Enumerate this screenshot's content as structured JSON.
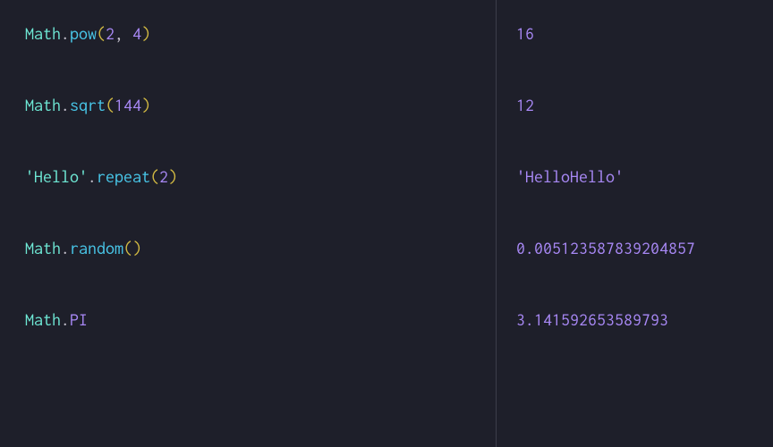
{
  "rows": [
    {
      "input": [
        {
          "cls": "tok-obj",
          "t": "Math"
        },
        {
          "cls": "tok-dot",
          "t": "."
        },
        {
          "cls": "tok-method",
          "t": "pow"
        },
        {
          "cls": "tok-paren",
          "t": "("
        },
        {
          "cls": "tok-num",
          "t": "2"
        },
        {
          "cls": "tok-comma",
          "t": ", "
        },
        {
          "cls": "tok-num",
          "t": "4"
        },
        {
          "cls": "tok-paren",
          "t": ")"
        }
      ],
      "output": {
        "cls": "out-num",
        "t": "16"
      }
    },
    {
      "input": [
        {
          "cls": "tok-obj",
          "t": "Math"
        },
        {
          "cls": "tok-dot",
          "t": "."
        },
        {
          "cls": "tok-method",
          "t": "sqrt"
        },
        {
          "cls": "tok-paren",
          "t": "("
        },
        {
          "cls": "tok-num",
          "t": "144"
        },
        {
          "cls": "tok-paren",
          "t": ")"
        }
      ],
      "output": {
        "cls": "out-num",
        "t": "12"
      }
    },
    {
      "input": [
        {
          "cls": "tok-str",
          "t": "'Hello'"
        },
        {
          "cls": "tok-dot",
          "t": "."
        },
        {
          "cls": "tok-method",
          "t": "repeat"
        },
        {
          "cls": "tok-paren",
          "t": "("
        },
        {
          "cls": "tok-num",
          "t": "2"
        },
        {
          "cls": "tok-paren",
          "t": ")"
        }
      ],
      "output": {
        "cls": "out-str",
        "t": "'HelloHello'"
      }
    },
    {
      "input": [
        {
          "cls": "tok-obj",
          "t": "Math"
        },
        {
          "cls": "tok-dot",
          "t": "."
        },
        {
          "cls": "tok-method",
          "t": "random"
        },
        {
          "cls": "tok-paren",
          "t": "("
        },
        {
          "cls": "tok-paren",
          "t": ")"
        }
      ],
      "output": {
        "cls": "out-num",
        "t": "0.005123587839204857"
      }
    },
    {
      "input": [
        {
          "cls": "tok-obj",
          "t": "Math"
        },
        {
          "cls": "tok-dot",
          "t": "."
        },
        {
          "cls": "tok-prop",
          "t": "PI"
        }
      ],
      "output": {
        "cls": "out-num",
        "t": "3.141592653589793"
      }
    }
  ]
}
